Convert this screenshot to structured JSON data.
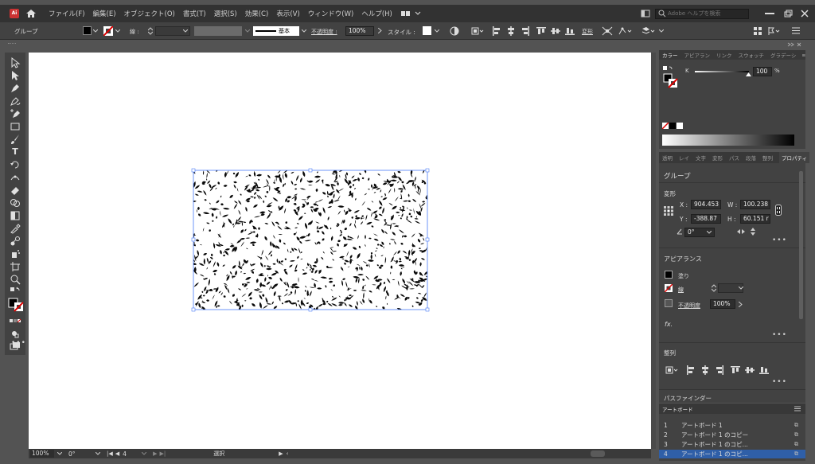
{
  "app": {
    "logo": "Ai",
    "accent": "#cc3333",
    "home_icon": "home-icon"
  },
  "menu": [
    "ファイル(F)",
    "編集(E)",
    "オブジェクト(O)",
    "書式(T)",
    "選択(S)",
    "効果(C)",
    "表示(V)",
    "ウィンドウ(W)",
    "ヘルプ(H)"
  ],
  "search": {
    "placeholder": "Adobe ヘルプを検索"
  },
  "control": {
    "selection_label": "グループ",
    "stroke_label": "線 :",
    "stroke_style": "基本",
    "opacity_label": "不透明度 :",
    "opacity_value": "100%",
    "style_label": "スタイル :",
    "transform_label": "変形"
  },
  "color_panel": {
    "tabs": [
      "カラー",
      "アピアラン",
      "リンク",
      "スウォッチ",
      "グラデーシ"
    ],
    "channel": "K",
    "value": "100",
    "unit": "%"
  },
  "properties_panel": {
    "tabs": [
      "透明",
      "レイ",
      "文字",
      "変形",
      "パス",
      "段落",
      "整列",
      "プロパティ"
    ],
    "selection": "グループ",
    "transform_title": "変形",
    "x_label": "X :",
    "x_value": "904.453",
    "w_label": "W :",
    "w_value": "100.238",
    "y_label": "Y :",
    "y_value": "-388.87",
    "h_label": "H :",
    "h_value": "60.151 r",
    "rotate_value": "0°",
    "appearance_title": "アピアランス",
    "fill_label": "塗り",
    "stroke_label": "線",
    "opacity_label": "不透明度",
    "opacity_value": "100%",
    "fx_label": "fx.",
    "align_title": "整列",
    "pathfinder_title": "パスファインダー"
  },
  "artboards_panel": {
    "title": "アートボード",
    "rows": [
      {
        "num": "1",
        "name": "アートボード 1"
      },
      {
        "num": "2",
        "name": "アートボード 1 のコピー"
      },
      {
        "num": "3",
        "name": "アートボード 1 のコピ..."
      },
      {
        "num": "4",
        "name": "アートボード 1 のコピ..."
      }
    ]
  },
  "status": {
    "zoom": "100%",
    "rotation": "0°",
    "artboard_num": "4",
    "mode": "選択"
  },
  "window_controls": [
    "minimize",
    "restore",
    "close"
  ]
}
